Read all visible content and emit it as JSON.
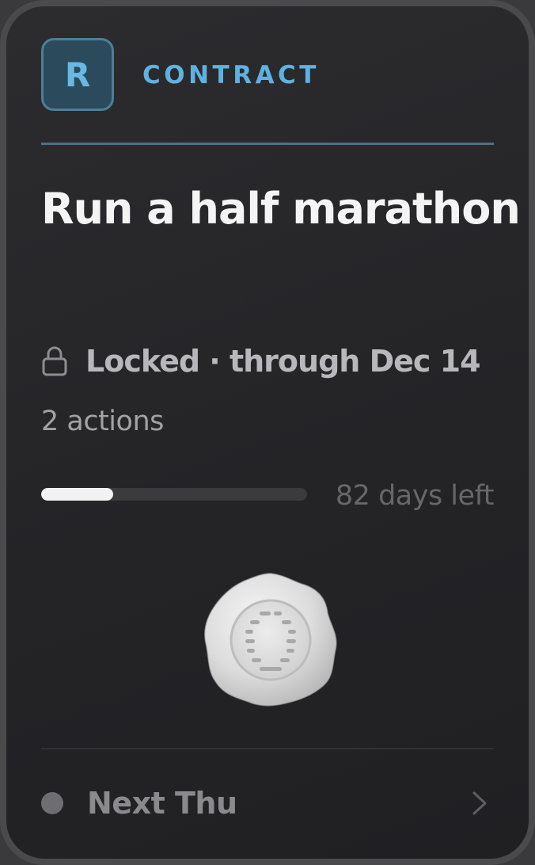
{
  "card": {
    "avatar_letter": "R",
    "kind_label": "CONTRACT",
    "title": "Run a half marathon",
    "status": {
      "icon": "lock-icon",
      "text": "Locked · through Dec 14"
    },
    "actions_count": "2 actions",
    "progress": {
      "fraction": 0.27,
      "days_left": "82 days left"
    },
    "seal": {
      "icon": "wax-seal-icon"
    },
    "footer": {
      "indicator_icon": "status-dot-icon",
      "next_label": "Next Thu",
      "chevron_icon": "chevron-right-icon"
    }
  },
  "colors": {
    "accent": "#5fb2e0",
    "avatar_bg": "#2b4b5d",
    "card_bg": "#262629",
    "title": "#f4f4f4",
    "progress_fill": "#f2f2f2"
  }
}
